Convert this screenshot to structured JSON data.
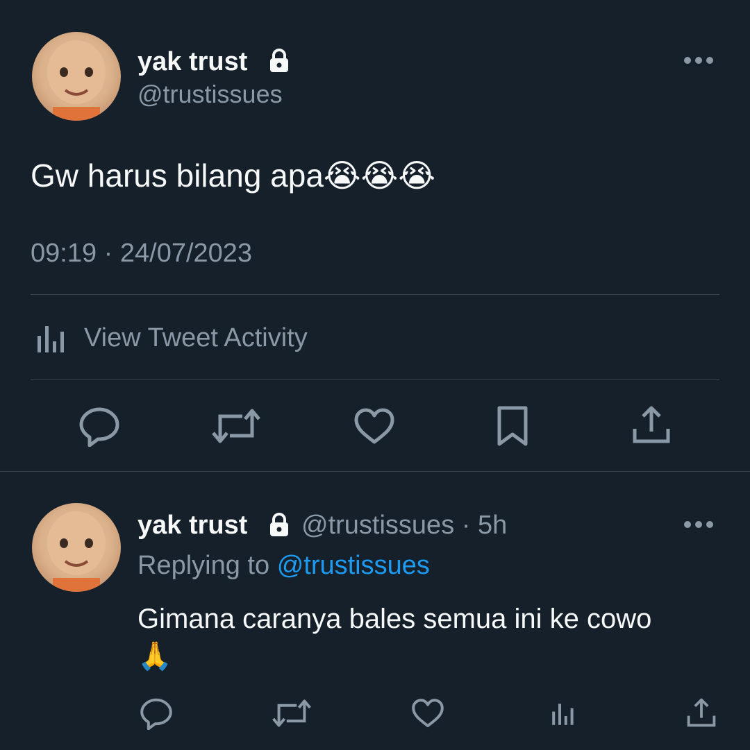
{
  "main_tweet": {
    "display_name": "yak trust",
    "handle": "@trustissues",
    "text": "Gw harus bilang apa😭😭😭",
    "timestamp": "09:19 · 24/07/2023",
    "activity_label": "View Tweet Activity",
    "icons": [
      "lock-icon",
      "more-icon",
      "analytics-icon",
      "reply-icon",
      "retweet-icon",
      "like-icon",
      "bookmark-icon",
      "share-icon"
    ]
  },
  "reply_tweet": {
    "display_name": "yak trust",
    "handle_time": "@trustissues · 5h",
    "replying_prefix": "Replying to",
    "replying_handle": "@trustissues",
    "text_line1": "Gimana caranya bales semua ini ke cowo",
    "text_line2": "🙏",
    "icons": [
      "lock-icon",
      "more-icon",
      "reply-icon",
      "retweet-icon",
      "like-icon",
      "analytics-icon",
      "share-icon"
    ]
  },
  "colors": {
    "background": "#15202b",
    "text": "#f7f9f9",
    "muted": "#8b98a5",
    "link": "#1d9bf0",
    "divider": "#38444d"
  }
}
